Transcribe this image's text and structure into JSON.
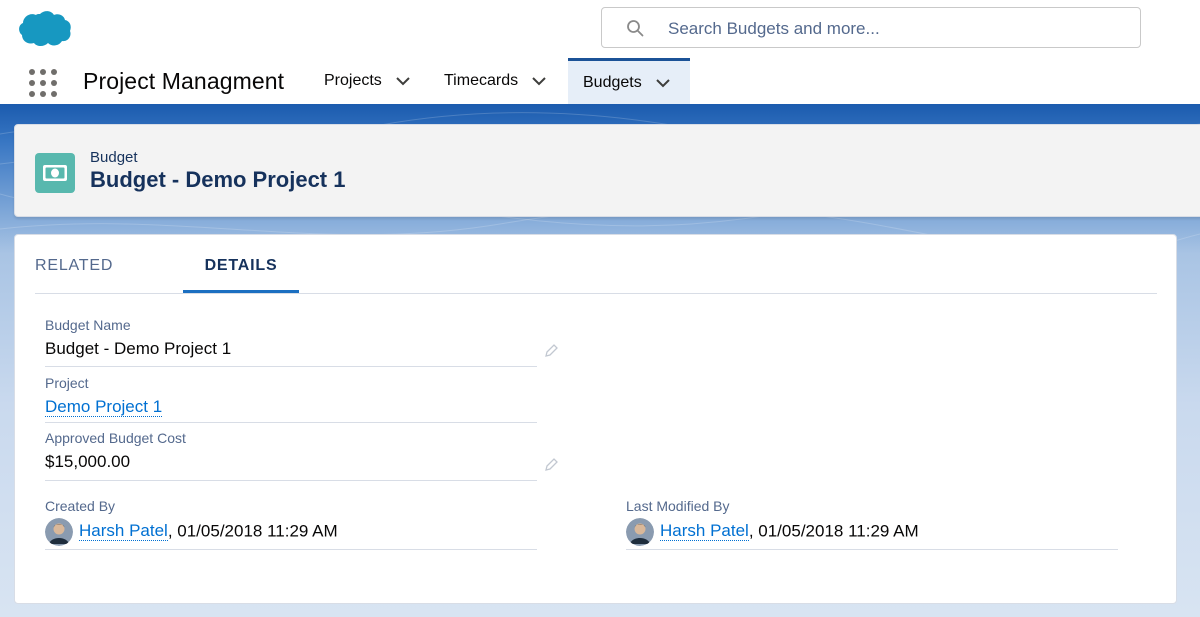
{
  "search": {
    "placeholder": "Search Budgets and more..."
  },
  "nav": {
    "app_name": "Project Managment",
    "items": [
      {
        "label": "Projects"
      },
      {
        "label": "Timecards"
      },
      {
        "label": "Budgets",
        "active": true
      }
    ]
  },
  "record": {
    "object_type": "Budget",
    "title": "Budget - Demo Project 1"
  },
  "tabs": [
    {
      "label": "RELATED"
    },
    {
      "label": "DETAILS",
      "active": true
    }
  ],
  "fields": {
    "budget_name": {
      "label": "Budget Name",
      "value": "Budget - Demo Project 1"
    },
    "project": {
      "label": "Project",
      "value": "Demo Project 1"
    },
    "approved_budget_cost": {
      "label": "Approved Budget Cost",
      "value": "$15,000.00"
    },
    "created_by": {
      "label": "Created By",
      "user": "Harsh Patel",
      "datetime": ", 01/05/2018 11:29 AM"
    },
    "last_modified_by": {
      "label": "Last Modified By",
      "user": "Harsh Patel",
      "datetime": ", 01/05/2018 11:29 AM"
    }
  },
  "icons": {
    "logo": "salesforce-cloud-icon",
    "search": "search-icon",
    "launcher": "app-launcher-grid-icon",
    "chevron": "chevron-down-icon",
    "record": "money-icon",
    "edit": "pencil-icon"
  },
  "colors": {
    "brand_blue": "#1b5297",
    "link": "#0070d2",
    "record_icon": "#58b8ae",
    "logo": "#1798c1"
  }
}
